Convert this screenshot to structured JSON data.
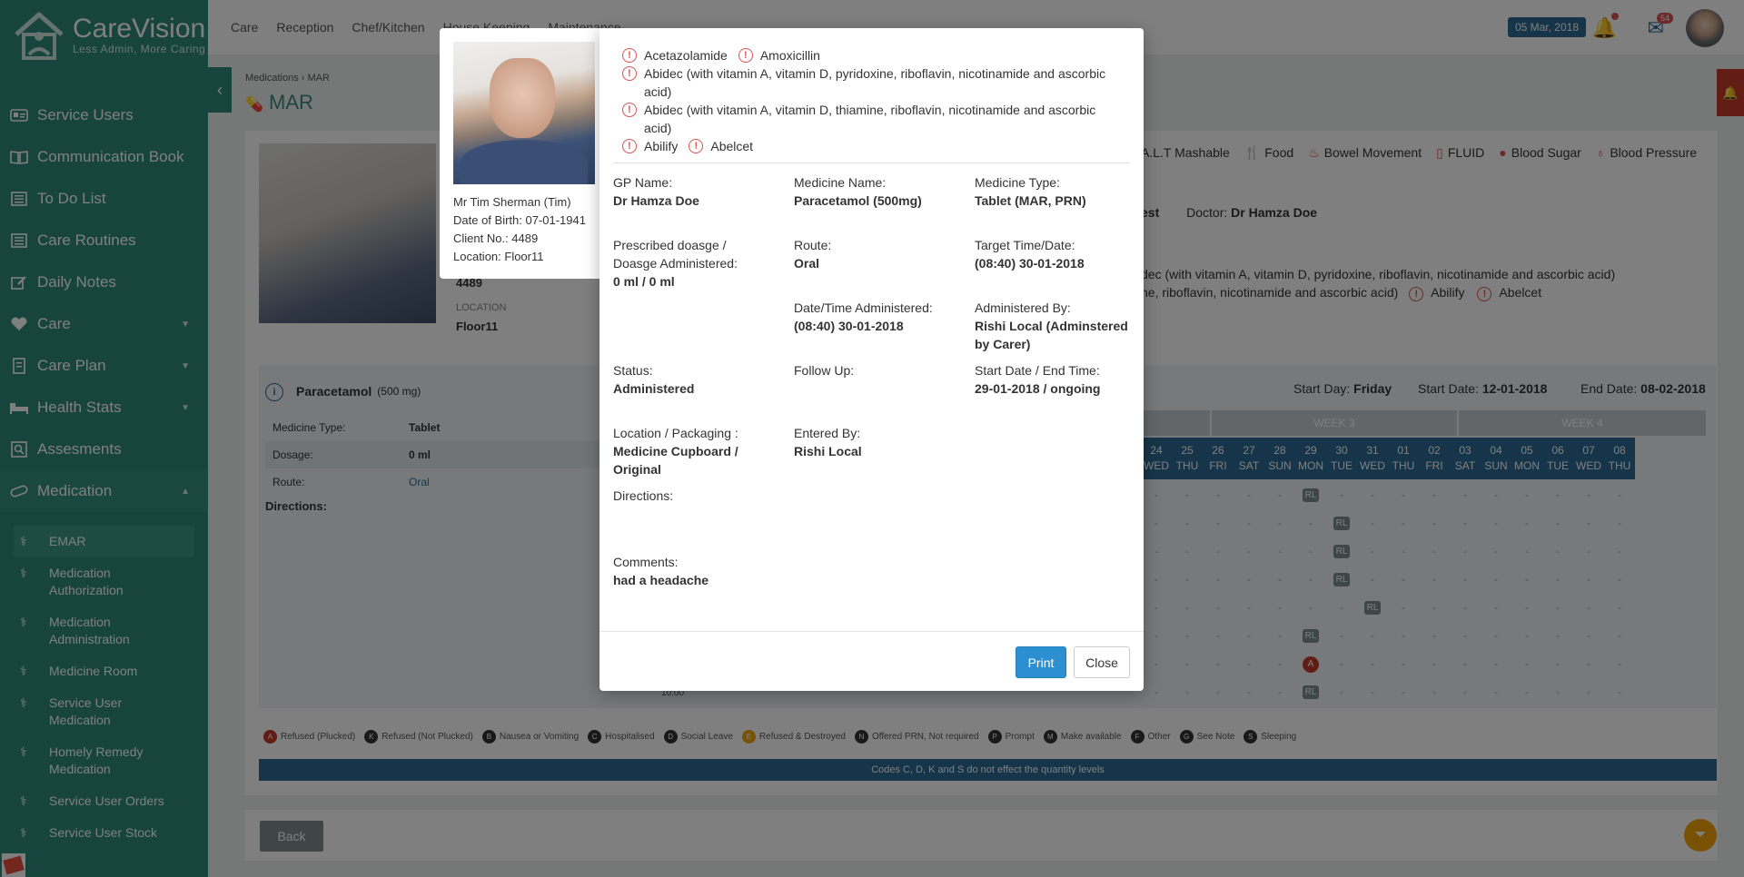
{
  "app": {
    "logo_title": "CareVision",
    "logo_tagline": "Less Admin, More Caring"
  },
  "sidebar": {
    "items": [
      {
        "label": "Service Users",
        "icon": "id-card-icon"
      },
      {
        "label": "Communication Book",
        "icon": "book-icon"
      },
      {
        "label": "To Do List",
        "icon": "list-icon"
      },
      {
        "label": "Care Routines",
        "icon": "list-icon"
      },
      {
        "label": "Daily Notes",
        "icon": "edit-icon"
      },
      {
        "label": "Care",
        "icon": "heart-icon"
      },
      {
        "label": "Care Plan",
        "icon": "notebook-icon"
      },
      {
        "label": "Health Stats",
        "icon": "bed-icon"
      },
      {
        "label": "Assesments",
        "icon": "search-icon"
      },
      {
        "label": "Medication",
        "icon": "pill-icon"
      }
    ],
    "subitems": [
      "EMAR",
      "Medication Authorization",
      "Medication Administration",
      "Medicine Room",
      "Service User Medication",
      "Homely Remedy Medication",
      "Service User Orders",
      "Service User Stock"
    ]
  },
  "topbar": {
    "menu": [
      "Care",
      "Reception",
      "Chef/Kitchen",
      "House Keeping",
      "Maintenance"
    ],
    "date": "05 Mar, 2018",
    "mail_count": "54"
  },
  "page": {
    "breadcrumb_1": "Medications",
    "breadcrumb_2": "MAR",
    "title": "MAR",
    "client_no_value": "4489",
    "location_label": "LOCATION",
    "location_value": "Floor11",
    "categories": [
      "A.L.T Mashable",
      "Food",
      "Bowel Movement",
      "FLUID",
      "Blood Sugar",
      "Blood Pressure"
    ],
    "dnr_fragment": "est",
    "doctor_label": "Doctor:",
    "doctor_value": "Dr Hamza Doe",
    "allergy_bg_line1": "dec (with vitamin A, vitamin D, pyridoxine, riboflavin, nicotinamide and ascorbic acid)",
    "allergy_bg_line2": "ne, riboflavin, nicotinamide and ascorbic acid)",
    "allergy_bg_extra": [
      "Abilify",
      "Abelcet"
    ],
    "med_name": "Paracetamol",
    "med_strength": "(500 mg)",
    "med_rows": [
      {
        "label": "Medicine Type:",
        "value": "Tablet"
      },
      {
        "label": "Dosage:",
        "value": "0 ml"
      },
      {
        "label": "Route:",
        "value": "Oral"
      }
    ],
    "directions_label": "Directions:",
    "start_day_label": "Start Day:",
    "start_day_value": "Friday",
    "start_date_label": "Start Date:",
    "start_date_value": "12-01-2018",
    "end_date_label": "End Date:",
    "end_date_value": "08-02-2018",
    "week3": "WEEK 3",
    "week4": "WEEK 4",
    "days": [
      {
        "n": "24",
        "d": "WED"
      },
      {
        "n": "25",
        "d": "THU"
      },
      {
        "n": "26",
        "d": "FRI"
      },
      {
        "n": "27",
        "d": "SAT"
      },
      {
        "n": "28",
        "d": "SUN"
      },
      {
        "n": "29",
        "d": "MON"
      },
      {
        "n": "30",
        "d": "TUE"
      },
      {
        "n": "31",
        "d": "WED"
      },
      {
        "n": "01",
        "d": "THU"
      },
      {
        "n": "02",
        "d": "FRI"
      },
      {
        "n": "03",
        "d": "SAT"
      },
      {
        "n": "04",
        "d": "SUN"
      },
      {
        "n": "05",
        "d": "MON"
      },
      {
        "n": "06",
        "d": "TUE"
      },
      {
        "n": "07",
        "d": "WED"
      },
      {
        "n": "08",
        "d": "THU"
      }
    ],
    "grid_badge_rl": "RL",
    "grid_badge_a": "A",
    "grid_time": "10:00",
    "legend": [
      {
        "code": "A",
        "label": "Refused (Plucked)",
        "color": "#c0392b"
      },
      {
        "code": "K",
        "label": "Refused (Not Plucked)",
        "color": "#333333"
      },
      {
        "code": "B",
        "label": "Nausea or Vomiting",
        "color": "#333333"
      },
      {
        "code": "C",
        "label": "Hospitalised",
        "color": "#333333"
      },
      {
        "code": "D",
        "label": "Social Leave",
        "color": "#333333"
      },
      {
        "code": "E",
        "label": "Refused & Destroyed",
        "color": "#f0a30a"
      },
      {
        "code": "N",
        "label": "Offered PRN, Not required",
        "color": "#333333"
      },
      {
        "code": "P",
        "label": "Prompt",
        "color": "#333333"
      },
      {
        "code": "M",
        "label": "Make available",
        "color": "#333333"
      },
      {
        "code": "F",
        "label": "Other",
        "color": "#333333"
      },
      {
        "code": "G",
        "label": "See Note",
        "color": "#333333"
      },
      {
        "code": "S",
        "label": "Sleeping",
        "color": "#333333"
      }
    ],
    "codes_note": "Codes C, D, K and S do not effect the quantity levels",
    "back_label": "Back"
  },
  "client_card": {
    "name": "Mr Tim Sherman (Tim)",
    "dob": "Date of Birth: 07-01-1941",
    "client_no": "Client No.: 4489",
    "location": "Location: Floor11"
  },
  "dialog": {
    "allergies_line1": [
      "Acetazolamide",
      "Amoxicillin"
    ],
    "allergy_abidec1": "Abidec (with vitamin A, vitamin D, pyridoxine, riboflavin, nicotinamide and ascorbic acid)",
    "allergy_abidec2": "Abidec (with vitamin A, vitamin D, thiamine, riboflavin, nicotinamide and ascorbic acid)",
    "allergies_last": [
      "Abilify",
      "Abelcet"
    ],
    "fields": {
      "gp_label": "GP Name:",
      "gp_value": "Dr Hamza Doe",
      "medname_label": "Medicine Name:",
      "medname_value": "Paracetamol (500mg)",
      "medtype_label": "Medicine Type:",
      "medtype_value": "Tablet (MAR, PRN)",
      "dosage_label": "Prescribed doasge / Doasge Administered:",
      "dosage_value": "0 ml / 0 ml",
      "route_label": "Route:",
      "route_value": "Oral",
      "target_label": "Target Time/Date:",
      "target_value": "(08:40) 30-01-2018",
      "admin_dt_label": "Date/Time Administered:",
      "admin_dt_value": "(08:40) 30-01-2018",
      "admin_by_label": "Administered By:",
      "admin_by_value": "Rishi Local (Adminstered by Carer)",
      "status_label": "Status:",
      "status_value": "Administered",
      "follow_label": "Follow Up:",
      "startend_label": "Start Date / End Time:",
      "startend_value": "29-01-2018 / ongoing",
      "location_label": "Location / Packaging :",
      "location_value": "Medicine Cupboard / Original",
      "entered_label": "Entered By:",
      "entered_value": "Rishi Local",
      "directions_label": "Directions:",
      "comments_label": "Comments:",
      "comments_value": "had a headache"
    },
    "print_label": "Print",
    "close_label": "Close"
  }
}
